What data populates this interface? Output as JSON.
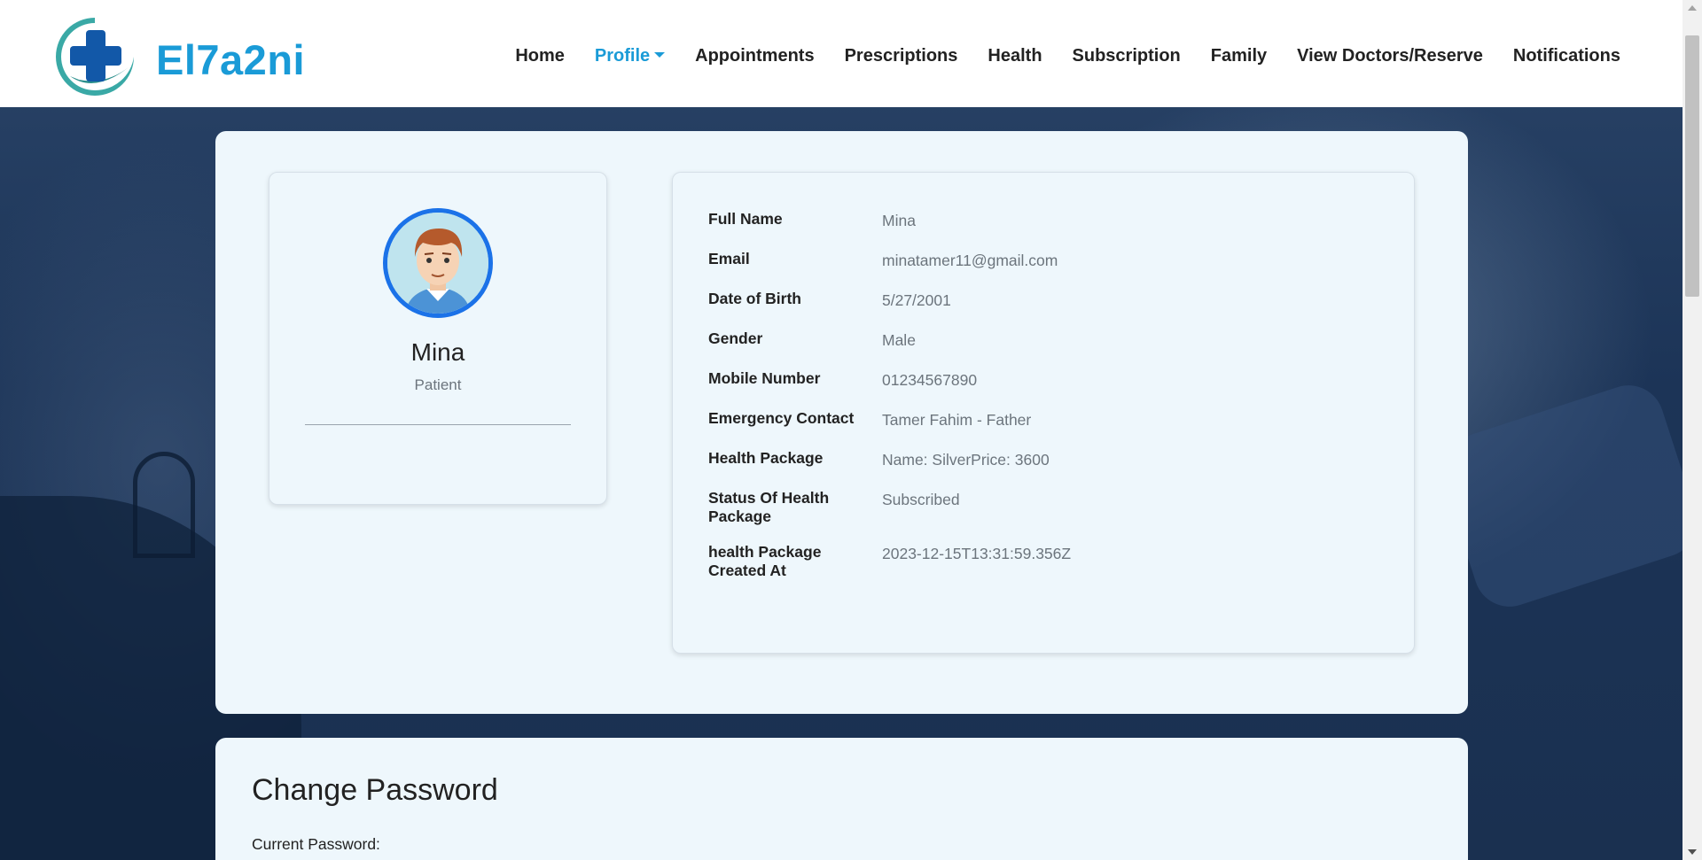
{
  "brand": {
    "name": "El7a2ni",
    "color": "#1a9bd7"
  },
  "nav": {
    "items": [
      {
        "label": "Home"
      },
      {
        "label": "Profile",
        "active": true
      },
      {
        "label": "Appointments"
      },
      {
        "label": "Prescriptions"
      },
      {
        "label": "Health"
      },
      {
        "label": "Subscription"
      },
      {
        "label": "Family"
      },
      {
        "label": "View Doctors/Reserve"
      },
      {
        "label": "Notifications"
      }
    ]
  },
  "profile": {
    "name": "Mina",
    "role": "Patient",
    "avatar_icon": "male-avatar-icon"
  },
  "details": [
    {
      "label": "Full Name",
      "value": "Mina"
    },
    {
      "label": "Email",
      "value": "minatamer11@gmail.com"
    },
    {
      "label": "Date of Birth",
      "value": "5/27/2001"
    },
    {
      "label": "Gender",
      "value": "Male"
    },
    {
      "label": "Mobile Number",
      "value": "01234567890"
    },
    {
      "label": "Emergency Contact",
      "value": "Tamer Fahim - Father"
    },
    {
      "label": "Health Package",
      "value": "Name: SilverPrice: 3600"
    },
    {
      "label": "Status Of Health Package",
      "value": "Subscribed"
    },
    {
      "label": "health Package Created At",
      "value": "2023-12-15T13:31:59.356Z"
    }
  ],
  "change_password": {
    "title": "Change Password",
    "current_label": "Current Password:"
  }
}
